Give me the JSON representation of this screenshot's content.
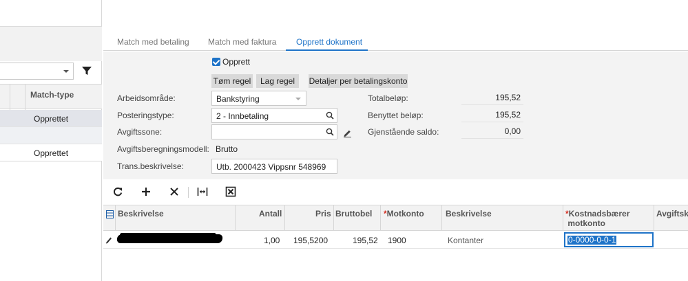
{
  "left_panel": {
    "column_header": "Match-type",
    "rows": [
      "Opprettet",
      "",
      "Opprettet"
    ]
  },
  "tabs": [
    {
      "label": "Match med betaling",
      "active": false
    },
    {
      "label": "Match med faktura",
      "active": false
    },
    {
      "label": "Opprett dokument",
      "active": true
    }
  ],
  "form": {
    "create_checkbox": {
      "label": "Opprett",
      "checked": true
    },
    "buttons": {
      "clear_rule": "Tøm regel",
      "make_rule": "Lag regel",
      "details_per_account": "Detaljer per betalingskonto"
    },
    "fields": {
      "work_area": {
        "label": "Arbeidsområde:",
        "value": "Bankstyring"
      },
      "posting_type": {
        "label": "Posteringstype:",
        "value": "2 - Innbetaling"
      },
      "tax_zone": {
        "label": "Avgiftssone:",
        "value": ""
      },
      "tax_model": {
        "label": "Avgiftsberegningsmodell:",
        "value": "Brutto"
      },
      "trans_desc": {
        "label": "Trans.beskrivelse:",
        "value": "Utb. 2000423 Vippsnr 548969"
      }
    },
    "totals": {
      "total": {
        "label": "Totalbeløp:",
        "value": "195,52"
      },
      "used": {
        "label": "Benyttet beløp:",
        "value": "195,52"
      },
      "remaining": {
        "label": "Gjenstående saldo:",
        "value": "0,00"
      }
    }
  },
  "grid": {
    "columns": {
      "beskrivelse": "Beskrivelse",
      "antall": "Antall",
      "pris": "Pris",
      "brutto": "Bruttobel",
      "motkonto": "Motkonto",
      "beskrivelse2": "Beskrivelse",
      "kost_line1": "Kostnadsbærer",
      "kost_line2": "motkonto",
      "avgift": "Avgiftsk"
    },
    "row": {
      "antall": "1,00",
      "pris": "195,5200",
      "brutto": "195,52",
      "motkonto": "1900",
      "beskrivelse2": "Kontanter",
      "kost": "0-0000-0-0-1"
    }
  },
  "colors": {
    "accent": "#1e73c8",
    "required": "#d52b1e",
    "panel_bg": "#f3f3f3"
  }
}
